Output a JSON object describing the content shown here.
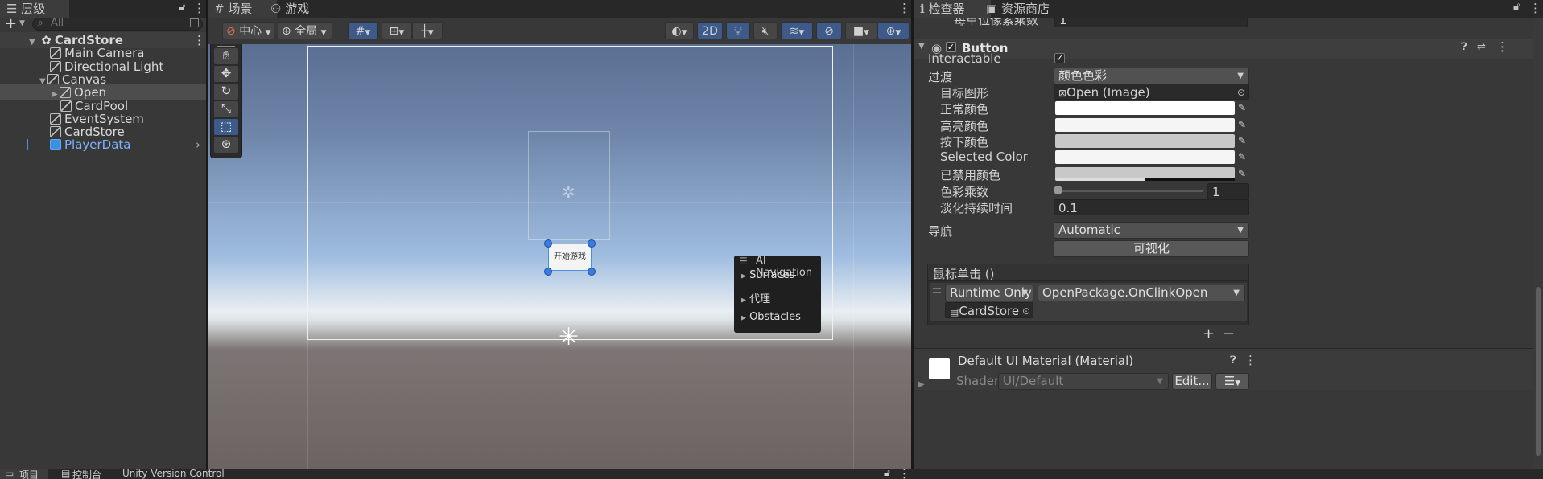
{
  "hierarchy": {
    "tab_label": "层级",
    "search_placeholder": "All",
    "add_label": "+",
    "items": [
      {
        "label": "CardStore",
        "indent": 0
      },
      {
        "label": "Main Camera",
        "indent": 1
      },
      {
        "label": "Directional Light",
        "indent": 1
      },
      {
        "label": "Canvas",
        "indent": 1
      },
      {
        "label": "Open",
        "indent": 2
      },
      {
        "label": "CardPool",
        "indent": 2
      },
      {
        "label": "EventSystem",
        "indent": 1
      },
      {
        "label": "CardStore",
        "indent": 1
      },
      {
        "label": "PlayerData",
        "indent": 1
      }
    ]
  },
  "scene": {
    "tab_scene": "场景",
    "tab_game": "游戏",
    "pivot_label": "中心",
    "space_label": "全局",
    "mode_2d": "2D",
    "button_text": "开始游戏",
    "overlay": {
      "title": "AI Navigation",
      "items": [
        "Surfaces",
        "代理",
        "Obstacles"
      ]
    }
  },
  "inspector": {
    "tab_inspector": "检查器",
    "tab_store": "资源商店",
    "cut_label": "每单位像素乘数",
    "cut_value": "1",
    "component_title": "Button",
    "rows": {
      "interactable": "Interactable",
      "transition": "过渡",
      "transition_value": "颜色色彩",
      "target_graphic": "目标图形",
      "target_graphic_value": "Open (Image)",
      "normal_color": "正常颜色",
      "highlight_color": "高亮颜色",
      "pressed_color": "按下颜色",
      "selected_color": "Selected Color",
      "disabled_color": "已禁用颜色",
      "color_multiplier": "色彩乘数",
      "color_multiplier_value": "1",
      "fade_duration": "淡化持续时间",
      "fade_duration_value": "0.1",
      "navigation": "导航",
      "navigation_value": "Automatic",
      "visualize": "可视化"
    },
    "event": {
      "title": "鼠标单击 ()",
      "runtime": "Runtime Only",
      "function": "OpenPackage.OnClinkOpen",
      "object": "CardStore (C"
    },
    "material": {
      "title": "Default UI Material (Material)",
      "shader_label": "Shader",
      "shader_value": "UI/Default",
      "edit_label": "Edit..."
    }
  },
  "bottom": {
    "tab_project": "项目",
    "tab_console": "控制台",
    "tab_vcs": "Unity Version Control"
  }
}
